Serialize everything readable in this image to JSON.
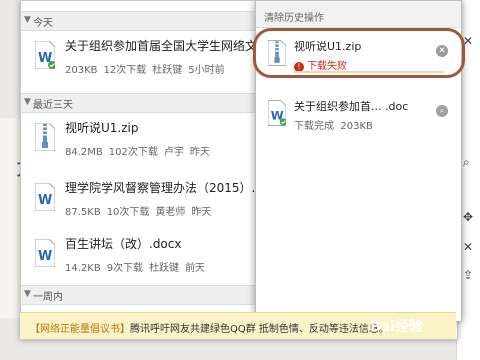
{
  "sections": {
    "today": "今天",
    "last3": "最近三天",
    "week": "一周内"
  },
  "files": [
    {
      "name": "关于组织参加首届全国大学生网络文化节的",
      "size": "203KB",
      "downloads": "12次下载",
      "author": "杜跃键",
      "time": "5小时前",
      "type": "doc"
    },
    {
      "name": "视听说U1.zip",
      "size": "84.2MB",
      "downloads": "102次下载",
      "author": "卢宇",
      "time": "昨天",
      "type": "zip"
    },
    {
      "name": "理学院学风督察管理办法（2015）.doc",
      "size": "87.5KB",
      "downloads": "10次下载",
      "author": "黄老师",
      "time": "昨天",
      "type": "doc"
    },
    {
      "name": "百生讲坛（改）.docx",
      "size": "14.2KB",
      "downloads": "9次下载",
      "author": "杜跃键",
      "time": "前天",
      "type": "doc"
    }
  ],
  "history": {
    "clear_label": "清除历史操作",
    "items": [
      {
        "name": "视听说U1.zip",
        "status": "下载失败",
        "status_type": "fail",
        "type": "zip"
      },
      {
        "name": "关于组织参加首...",
        "ext": ".doc",
        "status": "下载完成",
        "size": "203KB",
        "status_type": "ok",
        "type": "doc"
      }
    ]
  },
  "notice": {
    "tag": "【网络正能量倡议书】",
    "text": "腾讯呼吁网友共建绿色QQ群 抵制色情、反动等违法信息。"
  },
  "watermark": "Bai经验",
  "colors": {
    "word_blue": "#2a67b8",
    "fail_red": "#cc2a1a",
    "ring": "#9c5a3c",
    "notice_bg": "#fbf3c8"
  }
}
